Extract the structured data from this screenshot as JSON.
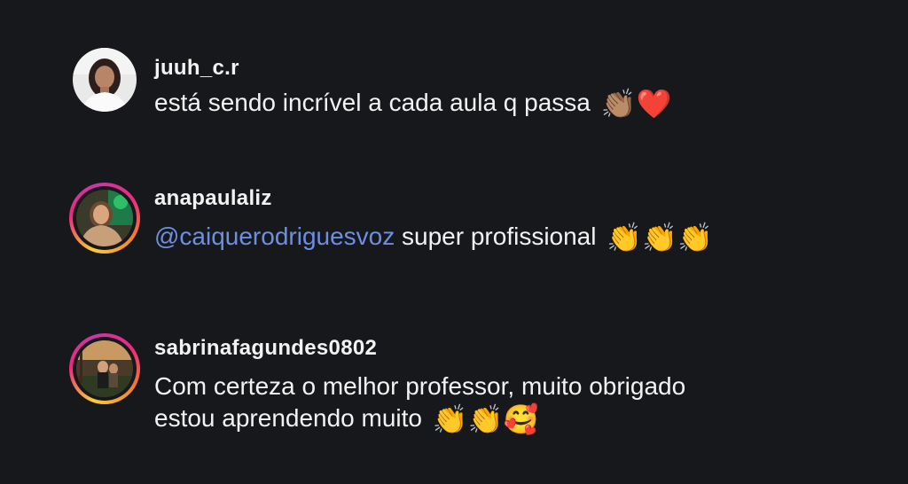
{
  "comments": [
    {
      "username": "juuh_c.r",
      "text": "está sendo incrível a cada aula q passa",
      "emojis": "👏🏽❤️",
      "has_story_ring": false
    },
    {
      "username": "anapaulaliz",
      "mention": "@caiquerodriguesvoz",
      "text": " super profissional",
      "emojis": "👏👏👏",
      "has_story_ring": true
    },
    {
      "username": "sabrinafagundes0802",
      "text_line1": "Com certeza o melhor professor, muito obrigado",
      "text_line2": "estou aprendendo muito",
      "emojis": "👏👏🥰",
      "has_story_ring": true
    }
  ],
  "colors": {
    "background": "#17181c",
    "text": "#f2f2f2",
    "mention": "#6d8fe0",
    "story_ring_gradient": [
      "#f9ce34",
      "#ee2a7b",
      "#c837ab",
      "#f58529"
    ]
  }
}
